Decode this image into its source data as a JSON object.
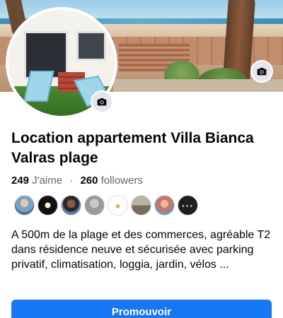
{
  "page": {
    "title": "Location appartement Villa Bianca Valras plage",
    "likes_count": "249",
    "likes_label": "J'aime",
    "separator": "·",
    "followers_count": "260",
    "followers_label": "followers",
    "description": "A 500m de la plage et des commerces, agréable T2 dans résidence neuve et sécurisée avec parking privatif, climatisation, loggia, jardin, vélos ...",
    "more_followers_label": "···"
  },
  "buttons": {
    "promote_label": "Promouvoir"
  },
  "icons": {
    "cover_photo_edit": "camera-icon",
    "profile_photo_edit": "camera-icon"
  },
  "colors": {
    "primary": "#1877f2",
    "secondary_text": "#65676b",
    "text": "#050505",
    "icon_button_bg": "#e4e6eb"
  }
}
